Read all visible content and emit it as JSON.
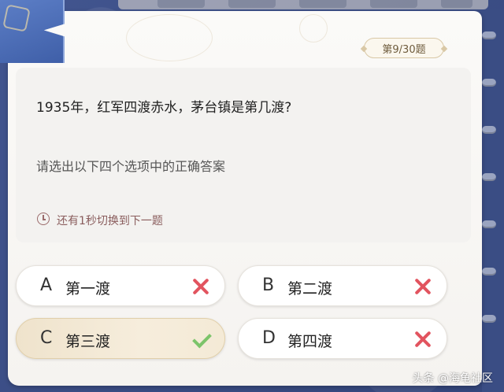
{
  "counter": "第9/30题",
  "question": "1935年，红军四渡赤水，茅台镇是第几渡?",
  "instruction": "请选出以下四个选项中的正确答案",
  "timer": {
    "icon": "clock-icon",
    "text": "还有1秒切换到下一题"
  },
  "options": [
    {
      "letter": "A",
      "text": "第一渡",
      "result": "wrong",
      "icon": "cross-icon"
    },
    {
      "letter": "B",
      "text": "第二渡",
      "result": "wrong",
      "icon": "cross-icon"
    },
    {
      "letter": "C",
      "text": "第三渡",
      "result": "correct",
      "icon": "check-icon"
    },
    {
      "letter": "D",
      "text": "第四渡",
      "result": "wrong",
      "icon": "cross-icon"
    }
  ],
  "watermark": "头条 @海龟社区",
  "colors": {
    "background": "#3c4f86",
    "card": "#fbfaf8",
    "wrong": "#e2545f",
    "correct": "#7cc46a",
    "selected_option": "#efe3cc"
  }
}
